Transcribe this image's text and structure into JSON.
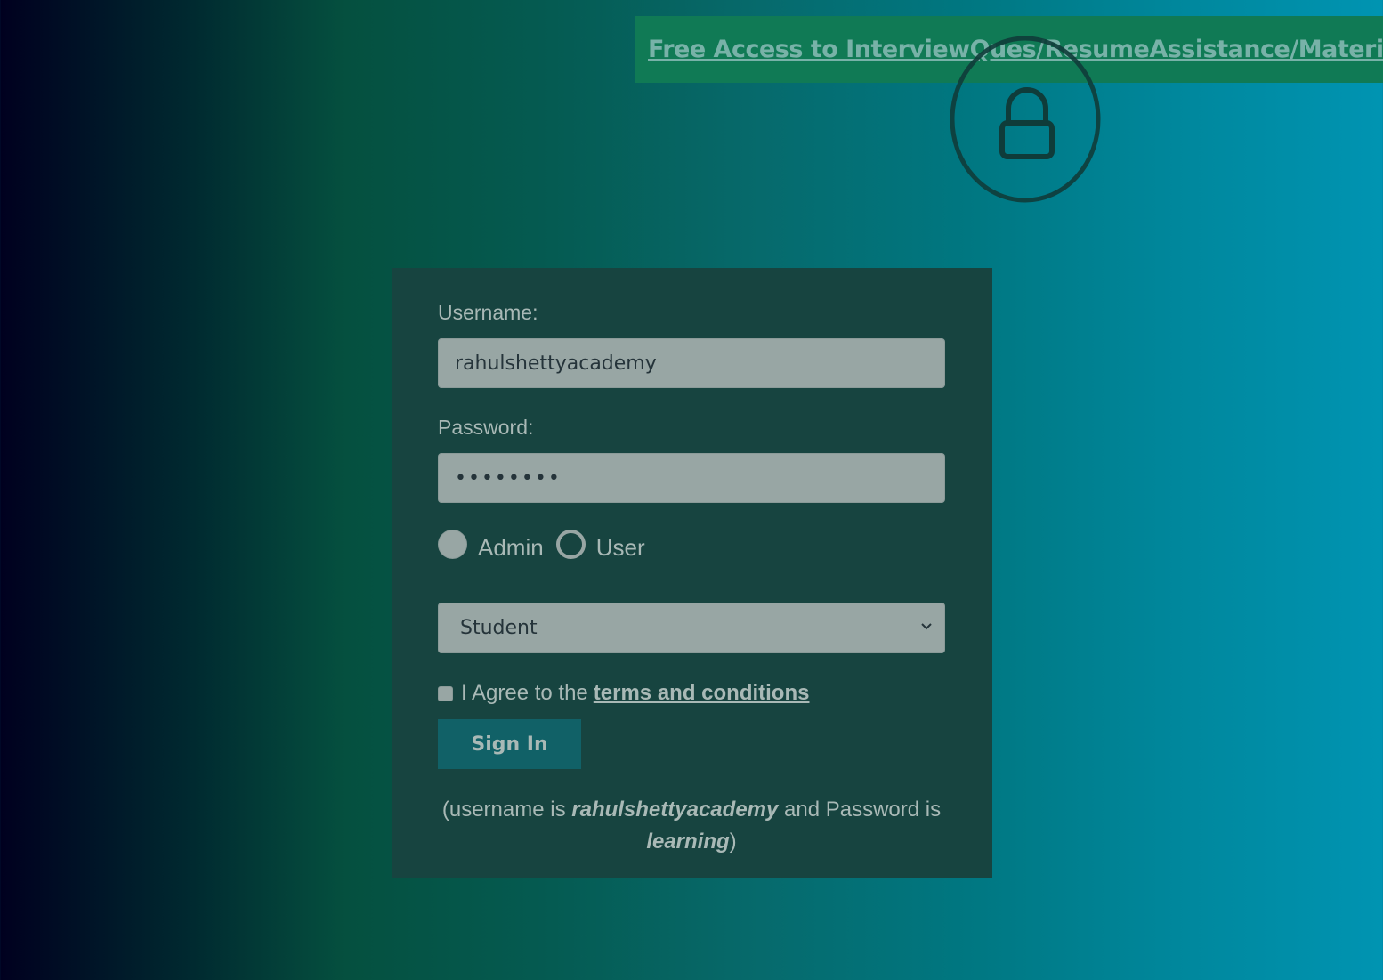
{
  "banner": {
    "link_text": "Free Access to InterviewQues/ResumeAssistance/Material"
  },
  "form": {
    "username_label": "Username:",
    "username_value": "rahulshettyacademy",
    "password_label": "Password:",
    "password_value": "••••••••",
    "radio_admin_label": "Admin",
    "radio_user_label": "User",
    "selected_role": "Admin",
    "role_select_value": "Student",
    "terms_prefix": "I Agree to the",
    "terms_link": "terms and conditions",
    "terms_checked": false,
    "signin_label": "Sign In"
  },
  "hint": {
    "open": "(username is",
    "username": "rahulshettyacademy",
    "middle": "and Password is",
    "password": "learning",
    "close": ")"
  },
  "icons": {
    "lock": "lock-icon",
    "chevron": "chevron-down-icon"
  },
  "colors": {
    "card_bg": "#174440",
    "banner_bg": "#107a55",
    "button_bg": "#116167"
  }
}
